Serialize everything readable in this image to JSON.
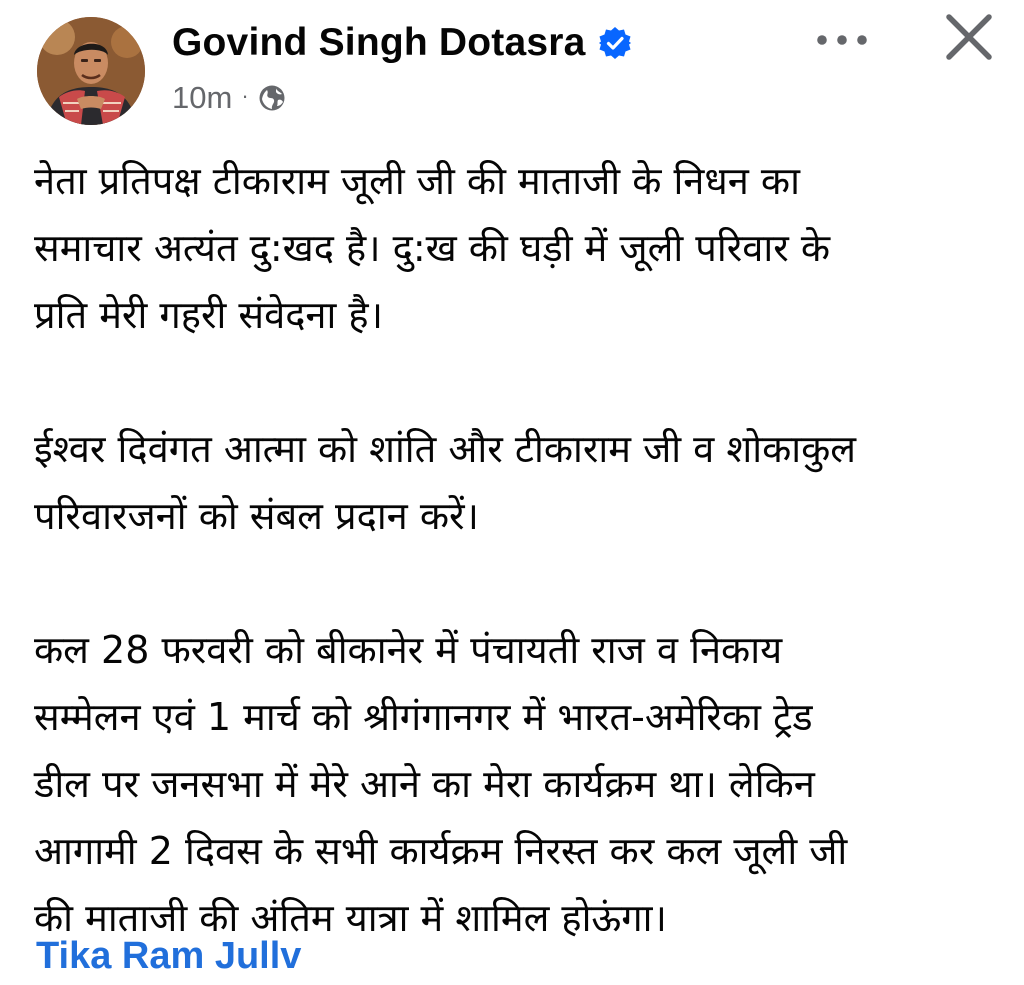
{
  "post": {
    "author": "Govind Singh Dotasra",
    "timestamp": "10m",
    "separator": "·",
    "audience_icon": "globe-icon",
    "verified_icon": "verified-badge-icon",
    "more_icon": "more-options-icon",
    "close_icon": "close-icon",
    "paragraphs": [
      "नेता प्रतिपक्ष टीकाराम जूली जी की माताजी के निधन का\nसमाचार अत्यंत दु:खद है। दु:ख की घड़ी में जूली परिवार के\nप्रति मेरी गहरी संवेदना है।",
      "ईश्वर दिवंगत आत्मा को शांति और टीकाराम जी व शोकाकुल\nपरिवारजनों को संबल प्रदान करें।",
      "कल 28 फरवरी को बीकानेर में पंचायती राज व निकाय\nसम्मेलन एवं 1 मार्च को श्रीगंगानगर में भारत-अमेरिका ट्रेड\nडील पर जनसभा में मेरे आने का मेरा कार्यक्रम था। लेकिन\nआगामी 2 दिवस के सभी कार्यक्रम निरस्त कर कल जूली जी\nकी माताजी की अंतिम यात्रा में शामिल होऊंगा।"
    ],
    "mention": "Tika Ram Jullv"
  },
  "colors": {
    "text": "#050505",
    "meta": "#65676b",
    "link": "#216fdb",
    "verified": "#0866ff"
  }
}
